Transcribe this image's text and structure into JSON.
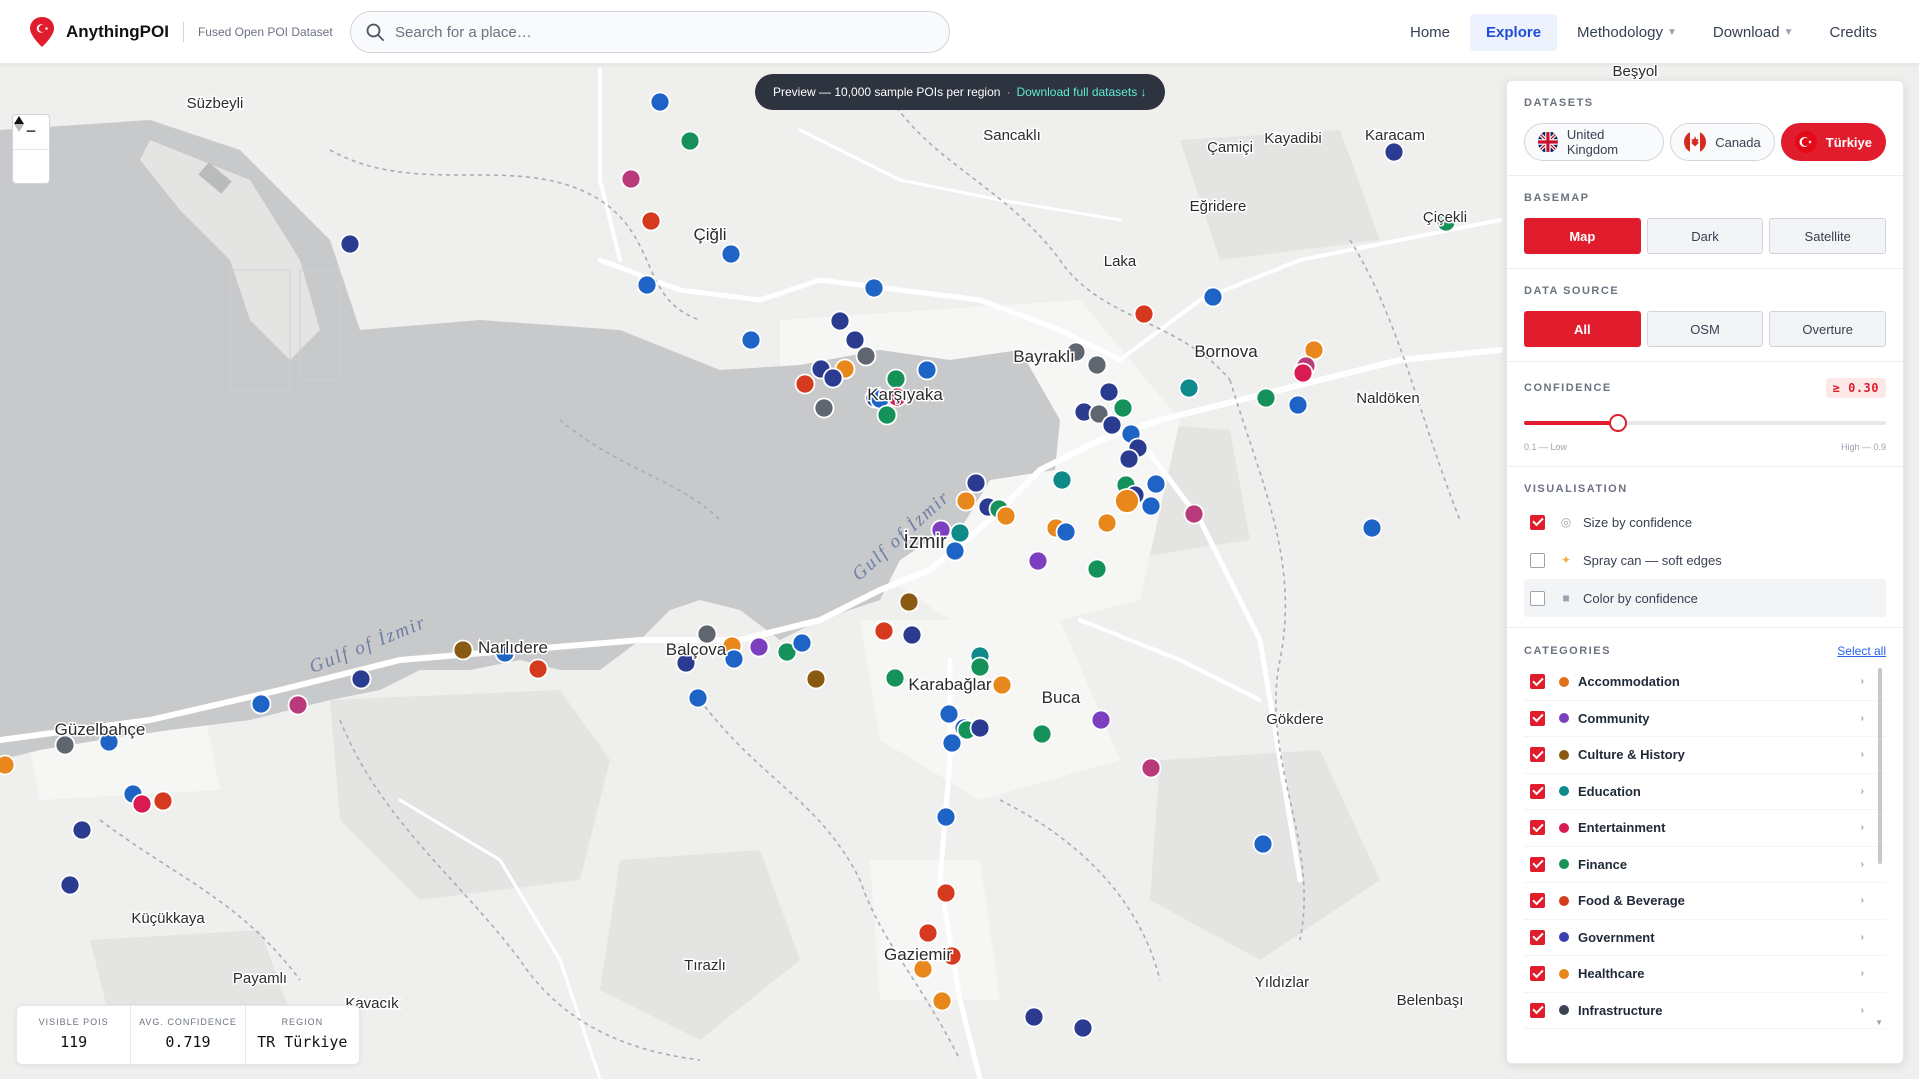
{
  "header": {
    "brand_name": "AnythingPOI",
    "tagline": "Fused Open POI Dataset",
    "search_placeholder": "Search for a place…",
    "nav": [
      {
        "label": "Home",
        "active": false,
        "dropdown": false
      },
      {
        "label": "Explore",
        "active": true,
        "dropdown": false
      },
      {
        "label": "Methodology",
        "active": false,
        "dropdown": true
      },
      {
        "label": "Download",
        "active": false,
        "dropdown": true
      },
      {
        "label": "Credits",
        "active": false,
        "dropdown": false
      }
    ]
  },
  "banner": {
    "text": "Preview — 10,000 sample POIs per region",
    "separator": "·",
    "link": "Download full datasets ↓"
  },
  "map": {
    "places": [
      "Süzbeyli",
      "Beşyol",
      "Sancaklı",
      "Kayadibi",
      "Karacam",
      "Çamiçi",
      "Çiğli",
      "Eğridere",
      "Çiçekli",
      "Laka",
      "Bayraklı",
      "Bornova",
      "Naldöken",
      "Karşıyaka",
      "İzmir",
      "Narlıdere",
      "Balçova",
      "Karabağlar",
      "Buca",
      "Gökdere",
      "Güzelbahçe",
      "Küçükkaya",
      "Payamlı",
      "Kavacık",
      "Tırazlı",
      "Gaziemir",
      "Yıldızlar",
      "Belenbaşı"
    ],
    "water_labels": [
      "Gulf of İzmir",
      "Gulf of İzmir"
    ]
  },
  "stats": [
    {
      "label": "Visible POIs",
      "value": "119"
    },
    {
      "label": "Avg. confidence",
      "value": "0.719"
    },
    {
      "label": "Region",
      "value": "TR Türkiye"
    }
  ],
  "sidebar": {
    "datasets_title": "Datasets",
    "datasets": [
      {
        "label": "United Kingdom",
        "active": false
      },
      {
        "label": "Canada",
        "active": false
      },
      {
        "label": "Türkiye",
        "active": true
      }
    ],
    "basemap_title": "Basemap",
    "basemaps": [
      {
        "label": "Map",
        "active": true
      },
      {
        "label": "Dark",
        "active": false
      },
      {
        "label": "Satellite",
        "active": false
      }
    ],
    "source_title": "Data Source",
    "sources": [
      {
        "label": "All",
        "active": true
      },
      {
        "label": "OSM",
        "active": false
      },
      {
        "label": "Overture",
        "active": false
      }
    ],
    "confidence_title": "Confidence",
    "confidence_badge": "≥ 0.30",
    "confidence_value": 0.26,
    "confidence_low": "0.1 — Low",
    "confidence_high": "High — 0.9",
    "visualisation_title": "Visualisation",
    "visualisation": [
      {
        "label": "Size by confidence",
        "checked": true,
        "icon": "target-icon"
      },
      {
        "label": "Spray can — soft edges",
        "checked": false,
        "icon": "sparkle-icon"
      },
      {
        "label": "Color by confidence",
        "checked": false,
        "icon": "square-icon"
      }
    ],
    "categories_title": "Categories",
    "select_all": "Select all",
    "categories": [
      {
        "label": "Accommodation",
        "color": "#e0701b",
        "checked": true
      },
      {
        "label": "Community",
        "color": "#7b3fbf",
        "checked": true
      },
      {
        "label": "Culture & History",
        "color": "#8a5a13",
        "checked": true
      },
      {
        "label": "Education",
        "color": "#0e8a8a",
        "checked": true
      },
      {
        "label": "Entertainment",
        "color": "#d81b50",
        "checked": true
      },
      {
        "label": "Finance",
        "color": "#15915a",
        "checked": true
      },
      {
        "label": "Food & Beverage",
        "color": "#d63a1e",
        "checked": true
      },
      {
        "label": "Government",
        "color": "#3a3fb0",
        "checked": true
      },
      {
        "label": "Healthcare",
        "color": "#e8881c",
        "checked": true
      },
      {
        "label": "Infrastructure",
        "color": "#3b4250",
        "checked": true
      }
    ]
  },
  "colors": {
    "accent": "#e11d2d",
    "water": "#c7c9cb",
    "land": "#efefed",
    "poi_blue": "#1e63c6",
    "poi_navy": "#2b3b8f",
    "poi_gray": "#5f6670"
  }
}
